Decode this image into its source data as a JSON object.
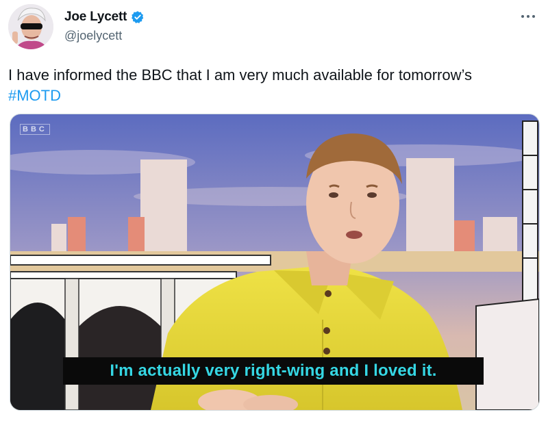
{
  "tweet": {
    "display_name": "Joe Lycett",
    "handle": "@joelycett",
    "verified_icon": "verified-badge-icon",
    "more_icon": "more-options-icon",
    "text": "I have informed the BBC that I am very much available for tomorrow’s",
    "hashtag": "#MOTD"
  },
  "media": {
    "watermark": "BBC",
    "subtitle": "I'm actually very right-wing and I loved it."
  },
  "colors": {
    "link": "#1d9bf0",
    "verified": "#1d9bf0",
    "subtitle_text": "#35d7e4",
    "jacket": "#e8dc3a"
  }
}
